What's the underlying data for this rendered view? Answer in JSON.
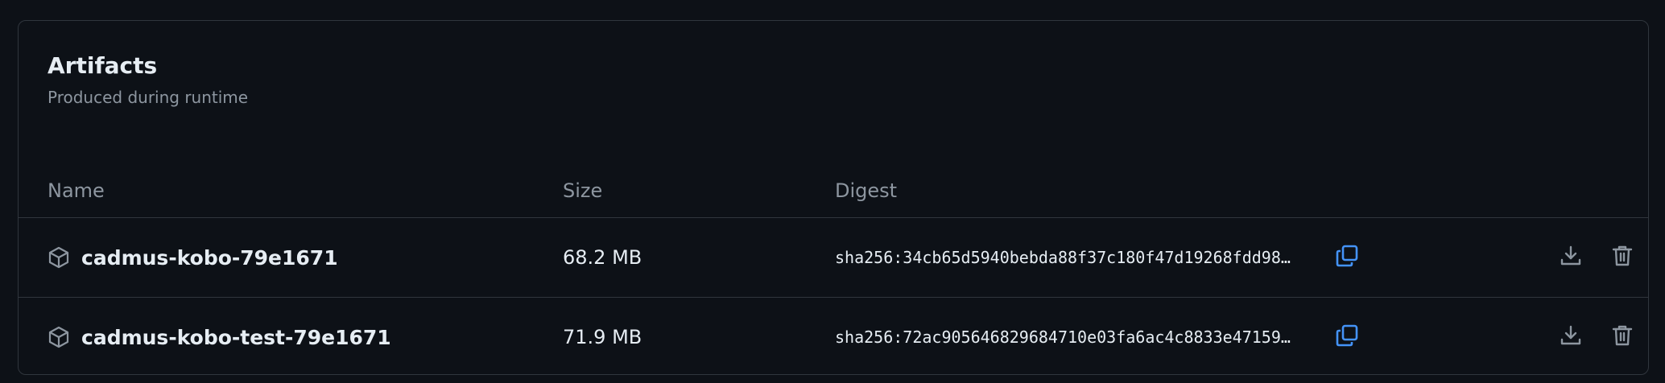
{
  "artifacts": {
    "title": "Artifacts",
    "subtitle": "Produced during runtime",
    "columns": {
      "name": "Name",
      "size": "Size",
      "digest": "Digest"
    },
    "rows": [
      {
        "name": "cadmus-kobo-79e1671",
        "size": "68.2 MB",
        "digest": "sha256:34cb65d5940bebda88f37c180f47d19268fdd98…"
      },
      {
        "name": "cadmus-kobo-test-79e1671",
        "size": "71.9 MB",
        "digest": "sha256:72ac905646829684710e03fa6ac4c8833e47159…"
      }
    ]
  },
  "icons": {
    "package": "package-icon",
    "copy": "copy-icon",
    "download": "download-icon",
    "delete": "trash-icon"
  },
  "colors": {
    "background": "#0d1117",
    "border": "#30363d",
    "text_primary": "#e6edf3",
    "text_muted": "#8d96a0",
    "accent": "#4493f8"
  }
}
